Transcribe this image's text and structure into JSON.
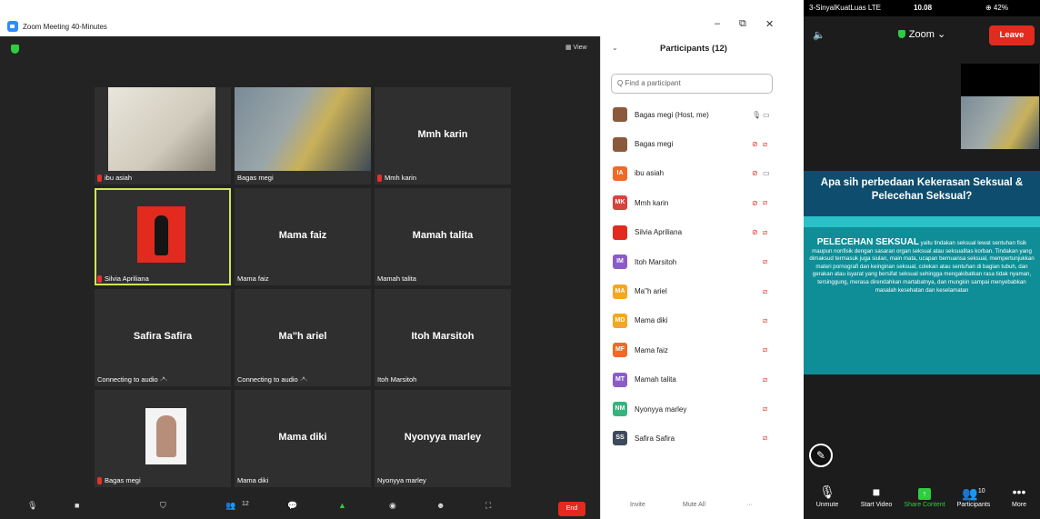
{
  "window": {
    "title": "Zoom Meeting 40-Minutes",
    "min_icon": "–",
    "restore_icon": "⧉",
    "close_icon": "✕",
    "view_label": "▦ View"
  },
  "tiles": [
    {
      "name": "",
      "caption": "ibu asiah",
      "muted": true
    },
    {
      "name": "",
      "caption": "Bagas megi",
      "muted": false
    },
    {
      "name": "Mmh karin",
      "caption": "Mmh karin",
      "muted": true
    },
    {
      "name": "",
      "caption": "Silvia Apriliana",
      "muted": true
    },
    {
      "name": "Mama faiz",
      "caption": "Mama faiz",
      "muted": false
    },
    {
      "name": "Mamah talita",
      "caption": "Mamah talita",
      "muted": false
    },
    {
      "name": "Safira Safira",
      "caption": "Connecting to audio ·^·",
      "muted": false
    },
    {
      "name": "Ma\"h ariel",
      "caption": "Connecting to audio ·^·",
      "muted": false
    },
    {
      "name": "Itoh Marsitoh",
      "caption": "Itoh Marsitoh",
      "muted": false
    },
    {
      "name": "",
      "caption": "Bagas megi",
      "muted": true
    },
    {
      "name": "Mama diki",
      "caption": "Mama diki",
      "muted": false
    },
    {
      "name": "Nyonyya marley",
      "caption": "Nyonyya marley",
      "muted": false
    }
  ],
  "toolbar": {
    "mic_icon": "🎙",
    "video_icon": "■",
    "security_icon": "⛉",
    "participants_icon": "👥",
    "participants_count": "12",
    "chat_icon": "💬",
    "share_icon": "▲",
    "record_icon": "◉",
    "reactions_icon": "☻",
    "apps_icon": "⛶",
    "end_label": "End"
  },
  "participants": {
    "header": "Participants (12)",
    "chevron": "⌄",
    "search_placeholder": "Q Find a participant",
    "list": [
      {
        "initials": "",
        "name": "Bagas megi (Host, me)",
        "color": "#8b5a3c",
        "mic_ok": true,
        "cam_ok": true
      },
      {
        "initials": "",
        "name": "Bagas megi",
        "color": "#8b5a3c",
        "mic_ok": false,
        "cam_ok": false
      },
      {
        "initials": "IA",
        "name": "ibu asiah",
        "color": "#ee6a26",
        "mic_ok": false,
        "cam_ok": true
      },
      {
        "initials": "MK",
        "name": "Mmh karin",
        "color": "#d6443d",
        "mic_ok": false,
        "cam_ok": false
      },
      {
        "initials": "",
        "name": "Silvia Apriliana",
        "color": "#e22a1e",
        "mic_ok": false,
        "cam_ok": false
      },
      {
        "initials": "IM",
        "name": "Itoh Marsitoh",
        "color": "#8b5cc7",
        "mic_ok": null,
        "cam_ok": false
      },
      {
        "initials": "MA",
        "name": "Ma\"h ariel",
        "color": "#f5a623",
        "mic_ok": null,
        "cam_ok": false
      },
      {
        "initials": "MD",
        "name": "Mama diki",
        "color": "#f5a623",
        "mic_ok": null,
        "cam_ok": false
      },
      {
        "initials": "MF",
        "name": "Mama faiz",
        "color": "#ee6a26",
        "mic_ok": null,
        "cam_ok": false
      },
      {
        "initials": "MT",
        "name": "Mamah talita",
        "color": "#8b5cc7",
        "mic_ok": null,
        "cam_ok": false
      },
      {
        "initials": "NM",
        "name": "Nyonyya marley",
        "color": "#36b37e",
        "mic_ok": null,
        "cam_ok": false
      },
      {
        "initials": "SS",
        "name": "Safira Safira",
        "color": "#3c4a5a",
        "mic_ok": null,
        "cam_ok": false
      }
    ],
    "invite_label": "Invite",
    "mute_all_label": "Mute All",
    "more_label": "···"
  },
  "phone": {
    "carrier": "3-SinyalKuatLuas  LTE",
    "time": "10.08",
    "battery": "⊕ 42%",
    "speaker_icon": "🔈",
    "app_label": "Zoom ⌄",
    "leave_label": "Leave",
    "slide_title": "Apa sih perbedaan Kekerasan Seksual & Pelecehan Seksual?",
    "slide_heading": "PELECEHAN SEKSUAL",
    "slide_body": " yaitu tindakan seksual lewat sentuhan fisik maupun nonfisik dengan sasaran organ seksual atau seksualitas korban. Tindakan yang dimaksud termasuk juga siulan, main mata, ucapan bernuansa seksual, mempertunjukkan materi pornografi dan keinginan seksual, colekan atau sentuhan di bagian tubuh, dan gerakan atau isyarat yang bersifat seksual sehingga mengakibatkan rasa tidak nyaman, tersinggung, merasa direndahkan martabatnya, dan mungkin sampai menyebabkan masalah kesehatan dan keselamatan",
    "pencil_icon": "✎",
    "buttons": {
      "unmute": {
        "icon": "🎙",
        "label": "Unmute"
      },
      "start_video": {
        "icon": "■",
        "label": "Start Video"
      },
      "share": {
        "icon": "↑",
        "label": "Share Content"
      },
      "participants": {
        "icon": "👥",
        "count": "10",
        "label": "Participants"
      },
      "more": {
        "icon": "•••",
        "label": "More"
      }
    }
  }
}
